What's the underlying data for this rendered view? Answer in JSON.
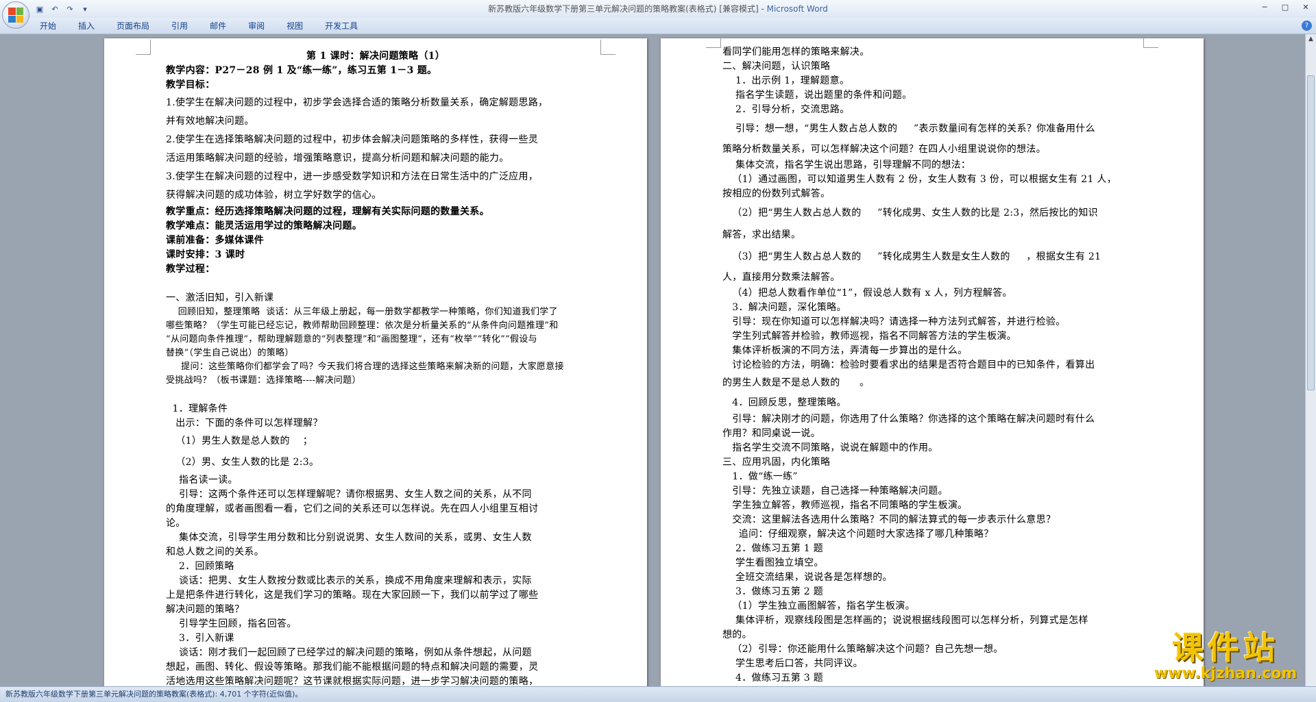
{
  "window": {
    "title_doc": "新苏教版六年级数学下册第三单元解决问题的策略教案(表格式) [兼容模式] - ",
    "title_app": "Microsoft Word",
    "minimize": "─",
    "maximize": "□",
    "close": "✕"
  },
  "colors": {
    "accent": "#15428b",
    "page": "#ffffff",
    "workspace": "#9aa3b0",
    "watermark": "#f2c400"
  },
  "quick_access": [
    {
      "icon": "save-icon",
      "glyph": "▣"
    },
    {
      "icon": "undo-icon",
      "glyph": "↶"
    },
    {
      "icon": "redo-icon",
      "glyph": "↷"
    },
    {
      "icon": "customize-icon",
      "glyph": "▾"
    }
  ],
  "ribbon": {
    "tabs": [
      "开始",
      "插入",
      "页面布局",
      "引用",
      "邮件",
      "审阅",
      "视图",
      "开发工具"
    ],
    "help": "?"
  },
  "left_page": {
    "title": "第 1 课时：解决问题策略（1）",
    "content_line": "教学内容：P27－28 例 1 及“练一练”，练习五第 1－3 题。",
    "goals_heading": "教学目标：",
    "goal1a": "1.使学生在解决问题的过程中，初步学会选择合适的策略分析数量关系，确定解题思路，",
    "goal1b": "并有效地解决问题。",
    "goal2a": "2.使学生在选择策略解决问题的过程中，初步体会解决问题策略的多样性，获得一些灵",
    "goal2b": "活运用策略解决问题的经验，增强策略意识，提高分析问题和解决问题的能力。",
    "goal3a": "3.使学生在解决问题的过程中，进一步感受数学知识和方法在日常生活中的广泛应用，",
    "goal3b": "获得解决问题的成功体验，树立学好数学的信心。",
    "key_point": "教学重点：经历选择策略解决问题的过程，理解有关实际问题的数量关系。",
    "difficulty": "教学难点：能灵活运用学过的策略解决问题。",
    "prep": "课前准备：多媒体课件",
    "hours": "课时安排：3 课时",
    "process": "教学过程：",
    "s1_heading": "一、激活旧知，引入新课",
    "s1_p1a": "    回顾旧知，整理策略  谈话：从三年级上册起，每一册数学都教学一种策略，你们知道我们学了",
    "s1_p1b": "哪些策略？（学生可能已经忘记，教师帮助回顾整理：依次是分析量关系的“从条件向问题推理”和",
    "s1_p1c": "“从问题向条件推理”，帮助理解题意的“列表整理”和“画图整理”，还有“枚举”“转化”“假设与",
    "s1_p1d": "替换”（学生自己说出）的策略）",
    "s1_p2a": "     提问：这些策略你们都学会了吗？今天我们将合理的选择这些策略来解决新的问题，大家愿意接",
    "s1_p2b": "受挑战吗？（板书课题：选择策略----解决问题）",
    "u1": "  1．理解条件",
    "u1_show": "   出示：下面的条件可以怎样理解？",
    "cond1": "   （1）男生人数是总人数的    ；",
    "cond2": "   （2）男、女生人数的比是 2:3。",
    "read": "    指名读一读。",
    "guide_a": "    引导：这两个条件还可以怎样理解呢？请你根据男、女生人数之间的关系，从不同",
    "guide_b": "的角度理解，或者画图看一看，它们之间的关系还可以怎样说。先在四人小组里互相讨",
    "guide_c": "论。",
    "collect_a": "    集体交流，引导学生用分数和比分别说说男、女生人数间的关系，或男、女生人数",
    "collect_b": "和总人数之间的关系。",
    "u2": "    2．回顾策略",
    "u2_a": "    谈话：把男、女生人数按分数或比表示的关系，换成不用角度来理解和表示，实际",
    "u2_b": "上是把条件进行转化，这是我们学习的策略。现在大家回顾一下，我们以前学过了哪些",
    "u2_c": "解决问题的策略？",
    "u2_d": "    引导学生回顾，指名回答。",
    "u3": "    3．引入新课",
    "u3_a": "    谈话：刚才我们一起回顾了已经学过的解决问题的策略，例如从条件想起，从问题",
    "u3_b": "想起，画图、转化、假设等策略。那我们能不能根据问题的特点和解决问题的需要，灵",
    "u3_c": "活地选用这些策略解决问题呢？这节课就根据实际问题，进一步学习解决问题的策略，"
  },
  "right_page": {
    "r0": "看同学们能用怎样的策略来解决。",
    "r_s2": "二、解决问题，认识策略",
    "r1": "    1．出示例 1，理解题意。",
    "r2": "    指名学生读题，说出题里的条件和问题。",
    "r3": "    2．引导分析，交流思路。",
    "r4": "    引导：想一想，“男生人数占总人数的     ”表示数量间有怎样的关系？你准备用什么",
    "r5": "策略分析数量关系，可以怎样解决这个问题？在四人小组里说说你的想法。",
    "r6": "    集体交流，指名学生说出思路，引导理解不同的想法：",
    "r7": "   （1）通过画图，可以知道男生人数有 2 份，女生人数有 3 份，可以根据女生有 21 人，",
    "r8": "按相应的份数列式解答。",
    "r9": "   （2）把“男生人数占总人数的     ”转化成男、女生人数的比是 2:3，然后按比的知识",
    "r10": "解答，求出结果。",
    "r11": "   （3）把“男生人数占总人数的     ”转化成男生人数是女生人数的     ，根据女生有 21",
    "r12": "人，直接用分数乘法解答。",
    "r13": "   （4）把总人数看作单位“1”，假设总人数有 x 人，列方程解答。",
    "r14": "   3．解决问题，深化策略。",
    "r15": "   引导：现在你知道可以怎样解决吗？请选择一种方法列式解答，并进行检验。",
    "r16": "   学生列式解答并检验，教师巡视，指名不同解答方法的学生板演。",
    "r17": "   集体评析板演的不同方法，弄清每一步算出的是什么。",
    "r18": "   讨论检验的方法，明确：检验时要看求出的结果是否符合题目中的已知条件，看算出",
    "r19": "的男生人数是不是总人数的      。",
    "r20": "   4．回顾反思，整理策略。",
    "r21": "   引导：解决刚才的问题，你选用了什么策略？你选择的这个策略在解决问题时有什么",
    "r22": "作用？和同桌说一说。",
    "r23": "   指名学生交流不同策略，说说在解题中的作用。",
    "r_s3": "三、应用巩固，内化策略",
    "r24": "   1．做“练一练”",
    "r25": "   引导：先独立读题，自己选择一种策略解决问题。",
    "r26": "   学生独立解答，教师巡视，指名不同策略的学生板演。",
    "r27": "   交流：这里解法各选用什么策略？不同的解法算式的每一步表示什么意思？",
    "r28": "     追问：仔细观察，解决这个问题时大家选择了哪几种策略？",
    "r29": "    2．做练习五第 1 题",
    "r30": "    学生看图独立填空。",
    "r31": "    全班交流结果，说说各是怎样想的。",
    "r32": "    3．做练习五第 2 题",
    "r33": "   （1）学生独立画图解答，指名学生板演。",
    "r34": "    集体评析，观察线段图是怎样画的；说说根据线段图可以怎样分析，列算式是怎样",
    "r35": "想的。",
    "r36": "   （2）引导：你还能用什么策略解决这个问题？自己先想一想。",
    "r37": "    学生思考后口答，共同评议。",
    "r38": "    4．做练习五第 3 题"
  },
  "statusbar": {
    "text": "新苏教版六年级数学下册第三单元解决问题的策略教案(表格式): 4,701 个字符(近似值)。"
  },
  "watermark": {
    "main": "课件站",
    "url": "www.kjzhan.com"
  }
}
